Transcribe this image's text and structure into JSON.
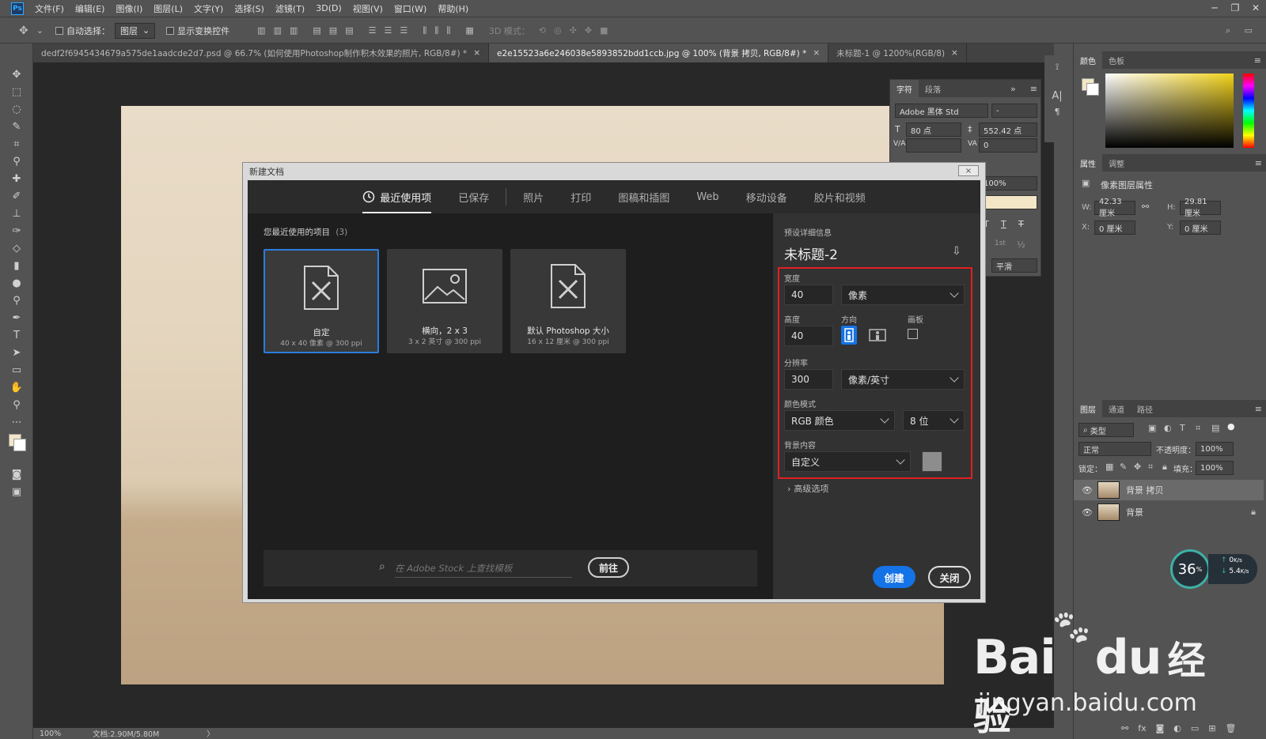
{
  "menu": {
    "logo": "Ps",
    "items": [
      "文件(F)",
      "编辑(E)",
      "图像(I)",
      "图层(L)",
      "文字(Y)",
      "选择(S)",
      "滤镜(T)",
      "3D(D)",
      "视图(V)",
      "窗口(W)",
      "帮助(H)"
    ]
  },
  "options": {
    "auto_select_label": "自动选择：",
    "auto_select_value": "图层",
    "show_transform_label": "显示变换控件",
    "mode_3d_label": "3D 模式："
  },
  "doc_tabs": [
    {
      "label": "dedf2f6945434679a575de1aadcde2d7.psd @ 66.7% (如何使用Photoshop制作积木效果的照片, RGB/8#) *",
      "close": "×"
    },
    {
      "label": "e2e15523a6e246038e5893852bdd1ccb.jpg @ 100% (背景 拷贝, RGB/8#) *",
      "close": "×"
    },
    {
      "label": "未标题-1 @ 1200%(RGB/8)",
      "close": "×"
    }
  ],
  "status": {
    "zoom": "100%",
    "doc_size": "文档:2.90M/5.80M",
    "arrow": "〉"
  },
  "char_panel": {
    "tabs": [
      "字符",
      "段落"
    ],
    "font_family": "Adobe 黑体 Std",
    "font_style": "-",
    "font_size": "80 点",
    "leading": "552.42 点",
    "kerning_label": "V/A",
    "tracking": "0",
    "scale": "100%",
    "aa": "平滑",
    "fractions": "½",
    "ordinal": "1st"
  },
  "color_panel": {
    "tabs": [
      "颜色",
      "色板"
    ]
  },
  "props_panel": {
    "tabs": [
      "属性",
      "调整"
    ],
    "title": "像素图层属性",
    "w_label": "W:",
    "w_value": "42.33 厘米",
    "h_label": "H:",
    "h_value": "29.81 厘米",
    "x_label": "X:",
    "x_value": "0 厘米",
    "y_label": "Y:",
    "y_value": "0 厘米"
  },
  "layers_panel": {
    "tabs": [
      "图层",
      "通道",
      "路径"
    ],
    "filter": "类型",
    "blend": "正常",
    "opacity_label": "不透明度：",
    "opacity": "100%",
    "lock_label": "锁定：",
    "fill_label": "填充：",
    "fill": "100%",
    "layers": [
      {
        "name": "背景 拷贝"
      },
      {
        "name": "背景"
      }
    ]
  },
  "net_widget": {
    "percent": "36",
    "pct_sign": "%",
    "up": "0",
    "down": "5.4",
    "unit": "K/s"
  },
  "dialog": {
    "title": "新建文档",
    "close": "×",
    "tabs": [
      "最近使用项",
      "已保存",
      "照片",
      "打印",
      "图稿和插图",
      "Web",
      "移动设备",
      "胶片和视频"
    ],
    "recent_label": "您最近使用的项目",
    "recent_count": "(3)",
    "presets": [
      {
        "name": "自定",
        "desc": "40 x 40 像素 @ 300 ppi"
      },
      {
        "name": "横向，2 x 3",
        "desc": "3 x 2 英寸 @ 300 ppi"
      },
      {
        "name": "默认 Photoshop 大小",
        "desc": "16 x 12 厘米 @ 300 ppi"
      }
    ],
    "search_placeholder": "在 Adobe Stock 上查找模板",
    "go_button": "前往",
    "details_label": "预设详细信息",
    "doc_name": "未标题-2",
    "width_label": "宽度",
    "width_value": "40",
    "width_unit": "像素",
    "height_label": "高度",
    "height_value": "40",
    "orientation_label": "方向",
    "artboard_label": "画板",
    "resolution_label": "分辨率",
    "resolution_value": "300",
    "resolution_unit": "像素/英寸",
    "color_mode_label": "颜色模式",
    "color_mode": "RGB 颜色",
    "bit_depth": "8 位",
    "background_label": "背景内容",
    "background": "自定义",
    "advanced": "高级选项",
    "create_button": "创建",
    "close_button": "关闭"
  },
  "watermark": {
    "brand_a": "Bai",
    "brand_b": "du",
    "brand_cn": "经验",
    "url": "jingyan.baidu.com"
  },
  "colors": {
    "accent": "#1473e6",
    "highlight": "#e02020",
    "selected_border": "#2a7ddd"
  }
}
